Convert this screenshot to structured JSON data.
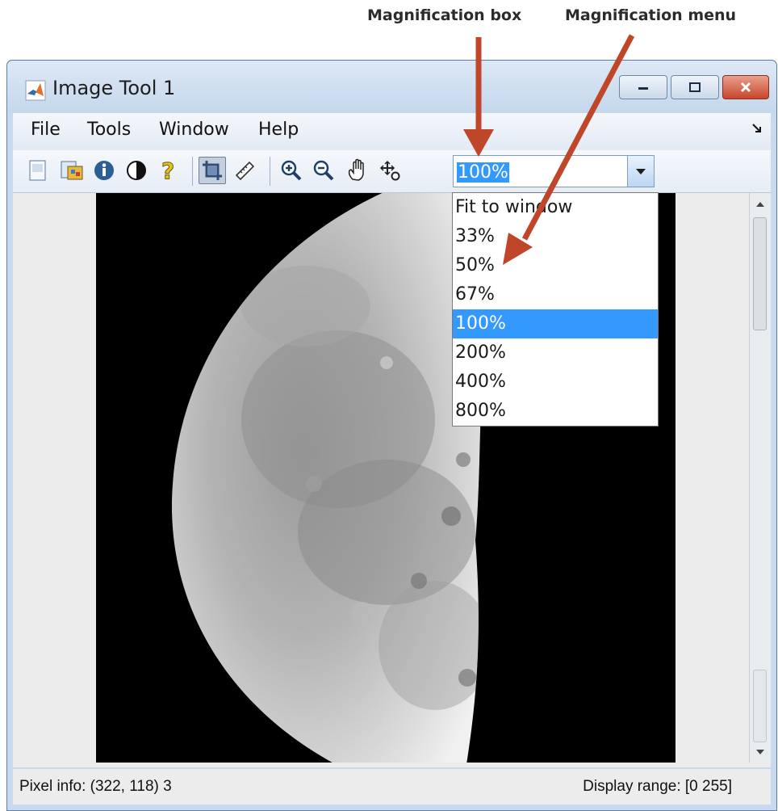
{
  "annotations": {
    "magnification_box_label": "Magnification box",
    "magnification_menu_label": "Magnification menu",
    "arrow_color": "#c0462a"
  },
  "window": {
    "title": "Image Tool 1",
    "controls": [
      "minimize-icon",
      "maximize-icon",
      "close-icon"
    ]
  },
  "menubar": {
    "file": "File",
    "tools": "Tools",
    "window": "Window",
    "help": "Help"
  },
  "toolbar": {
    "buttons": [
      "new-figure-icon",
      "image-info-icon",
      "info-icon",
      "contrast-icon",
      "help-icon",
      "crop-icon",
      "measure-distance-icon",
      "zoom-in-icon",
      "zoom-out-icon",
      "pan-hand-icon",
      "pixel-region-icon"
    ],
    "magnification_value": "100%"
  },
  "magnification_menu": {
    "options": [
      "Fit to window",
      "33%",
      "50%",
      "67%",
      "100%",
      "200%",
      "400%",
      "800%"
    ],
    "selected": "100%"
  },
  "statusbar": {
    "pixel_info": "Pixel info: (322, 118)  3",
    "display_range": "Display range: [0 255]"
  }
}
